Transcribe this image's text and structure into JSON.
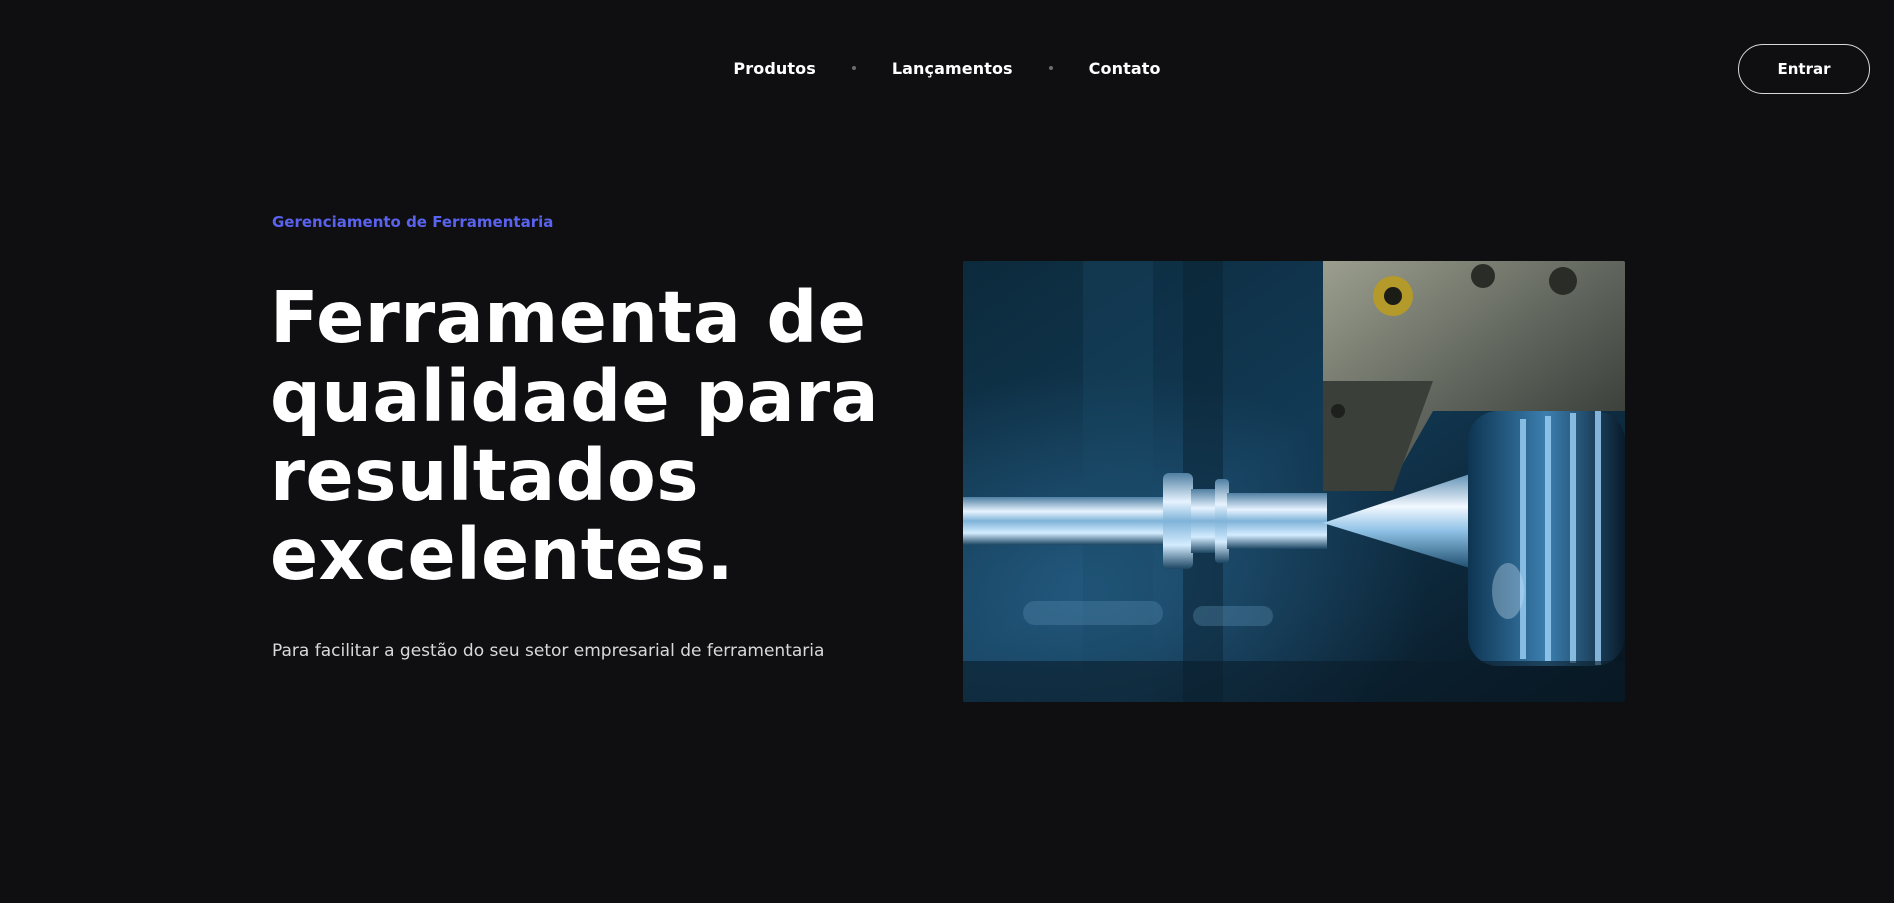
{
  "nav": {
    "items": [
      {
        "label": "Produtos"
      },
      {
        "label": "Lançamentos"
      },
      {
        "label": "Contato"
      }
    ],
    "login_label": "Entrar"
  },
  "hero": {
    "eyebrow": "Gerenciamento de Ferramentaria",
    "headline": "Ferramenta de qualidade para resultados excelentes.",
    "subtitle": "Para facilitar a gestão do seu setor empresarial de ferramentaria",
    "image_icon": "cnc-lathe-photo"
  },
  "colors": {
    "background": "#0f0f11",
    "accent": "#5a63f0",
    "text": "#ffffff"
  }
}
